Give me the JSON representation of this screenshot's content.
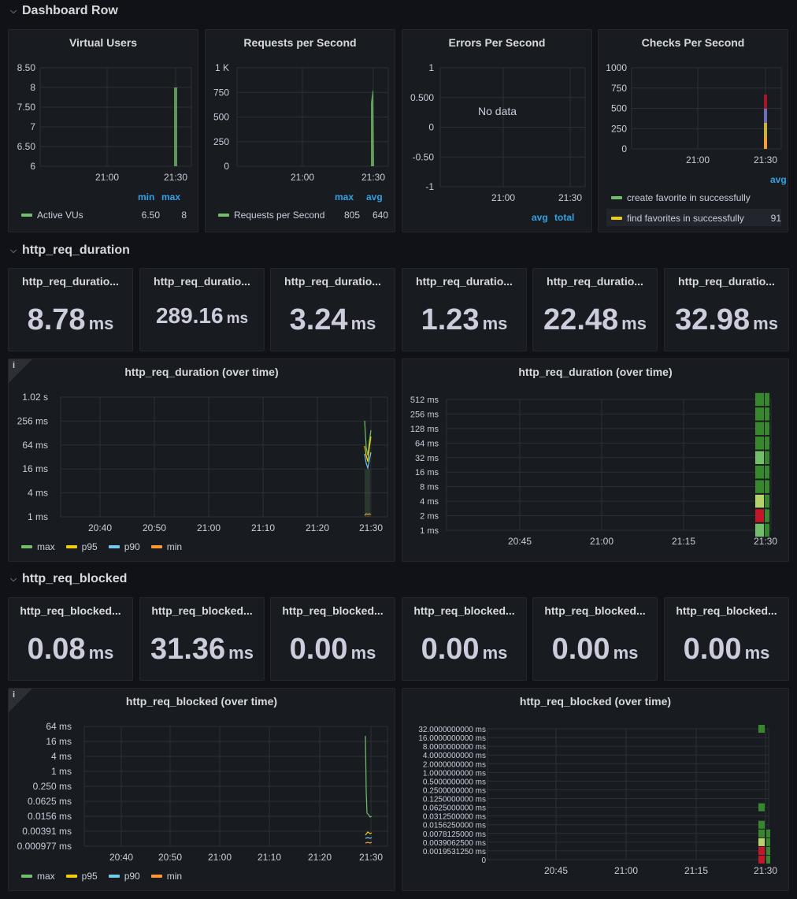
{
  "rows": {
    "dashboard": "Dashboard Row",
    "duration": "http_req_duration",
    "blocked": "http_req_blocked"
  },
  "colors": {
    "green": "#73bf69",
    "yellow": "#f2cc0c",
    "blue": "#5794f2",
    "cyan": "#73c9ea",
    "orange": "#ff9830",
    "accent": "#33a2e5",
    "red": "#c4162a",
    "darkgreen": "#37872d"
  },
  "vus": {
    "title": "Virtual Users",
    "y_ticks": [
      "8.50",
      "8",
      "7.50",
      "7",
      "6.50",
      "6"
    ],
    "x_ticks": [
      "21:00",
      "21:30"
    ],
    "legend_headers": [
      "min",
      "max"
    ],
    "series": [
      {
        "name": "Active VUs",
        "min": "6.50",
        "max": "8"
      }
    ]
  },
  "rps": {
    "title": "Requests per Second",
    "y_ticks": [
      "1 K",
      "750",
      "500",
      "250",
      "0"
    ],
    "x_ticks": [
      "21:00",
      "21:30"
    ],
    "legend_headers": [
      "max",
      "avg"
    ],
    "series": [
      {
        "name": "Requests per Second",
        "max": "805",
        "avg": "640"
      }
    ]
  },
  "eps": {
    "title": "Errors Per Second",
    "y_ticks": [
      "1",
      "0.500",
      "0",
      "-0.50",
      "-1"
    ],
    "x_ticks": [
      "21:00",
      "21:30"
    ],
    "nodata": "No data",
    "legend_headers": [
      "avg",
      "total"
    ]
  },
  "cps": {
    "title": "Checks Per Second",
    "y_ticks": [
      "1000",
      "750",
      "500",
      "250",
      "0"
    ],
    "x_ticks": [
      "21:00",
      "21:30"
    ],
    "legend_header": "avg",
    "series": [
      {
        "name": "create favorite in successfully",
        "color": "#73bf69",
        "value": ""
      },
      {
        "name": "find favorites in successfully",
        "color": "#f2cc0c",
        "value": "91"
      }
    ]
  },
  "duration_stats": [
    {
      "title": "http_req_duratio...",
      "value": "8.78",
      "unit": "ms"
    },
    {
      "title": "http_req_duratio...",
      "value": "289.16",
      "unit": "ms"
    },
    {
      "title": "http_req_duratio...",
      "value": "3.24",
      "unit": "ms"
    },
    {
      "title": "http_req_duratio...",
      "value": "1.23",
      "unit": "ms"
    },
    {
      "title": "http_req_duratio...",
      "value": "22.48",
      "unit": "ms"
    },
    {
      "title": "http_req_duratio...",
      "value": "32.98",
      "unit": "ms"
    }
  ],
  "duration_time": {
    "title": "http_req_duration (over time)",
    "info": "i",
    "y_ticks": [
      "1.02 s",
      "256 ms",
      "64 ms",
      "16 ms",
      "4 ms",
      "1 ms"
    ],
    "x_ticks": [
      "20:40",
      "20:50",
      "21:00",
      "21:10",
      "21:20",
      "21:30"
    ],
    "legend": [
      {
        "name": "max",
        "color": "#73bf69"
      },
      {
        "name": "p95",
        "color": "#f2cc0c"
      },
      {
        "name": "p90",
        "color": "#73c9ea"
      },
      {
        "name": "min",
        "color": "#ff9830"
      }
    ]
  },
  "duration_heat": {
    "title": "http_req_duration (over time)",
    "y_ticks": [
      "512 ms",
      "256 ms",
      "128 ms",
      "64 ms",
      "32 ms",
      "16 ms",
      "8 ms",
      "4 ms",
      "2 ms",
      "1 ms"
    ],
    "x_ticks": [
      "20:45",
      "21:00",
      "21:15",
      "21:30"
    ]
  },
  "blocked_stats": [
    {
      "title": "http_req_blocked...",
      "value": "0.08",
      "unit": "ms"
    },
    {
      "title": "http_req_blocked...",
      "value": "31.36",
      "unit": "ms"
    },
    {
      "title": "http_req_blocked...",
      "value": "0.00",
      "unit": "ms"
    },
    {
      "title": "http_req_blocked...",
      "value": "0.00",
      "unit": "ms"
    },
    {
      "title": "http_req_blocked...",
      "value": "0.00",
      "unit": "ms"
    },
    {
      "title": "http_req_blocked...",
      "value": "0.00",
      "unit": "ms"
    }
  ],
  "blocked_time": {
    "title": "http_req_blocked (over time)",
    "info": "i",
    "y_ticks": [
      "64 ms",
      "16 ms",
      "4 ms",
      "1 ms",
      "0.250 ms",
      "0.0625 ms",
      "0.0156 ms",
      "0.00391 ms",
      "0.000977 ms"
    ],
    "x_ticks": [
      "20:40",
      "20:50",
      "21:00",
      "21:10",
      "21:20",
      "21:30"
    ],
    "legend": [
      {
        "name": "max",
        "color": "#73bf69"
      },
      {
        "name": "p95",
        "color": "#f2cc0c"
      },
      {
        "name": "p90",
        "color": "#73c9ea"
      },
      {
        "name": "min",
        "color": "#ff9830"
      }
    ]
  },
  "blocked_heat": {
    "title": "http_req_blocked (over time)",
    "y_ticks": [
      "32.0000000000 ms",
      "16.0000000000 ms",
      "8.0000000000 ms",
      "4.0000000000 ms",
      "2.0000000000 ms",
      "1.0000000000 ms",
      "0.5000000000 ms",
      "0.2500000000 ms",
      "0.1250000000 ms",
      "0.0625000000 ms",
      "0.0312500000 ms",
      "0.0156250000 ms",
      "0.0078125000 ms",
      "0.0039062500 ms",
      "0.0019531250 ms",
      "0"
    ],
    "x_ticks": [
      "20:45",
      "21:00",
      "21:15",
      "21:30"
    ]
  }
}
